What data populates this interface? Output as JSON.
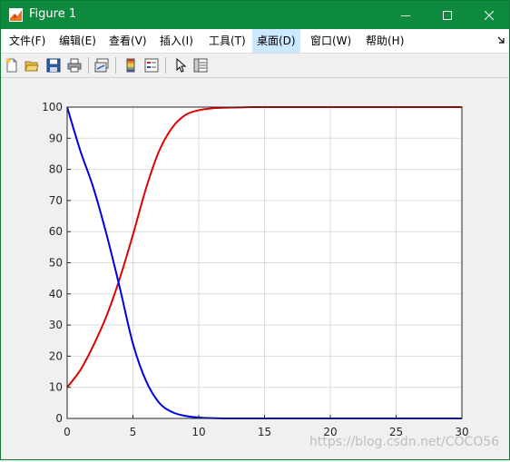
{
  "window": {
    "title": "Figure 1",
    "controls": {
      "minimize": "minimize",
      "maximize": "maximize",
      "close": "close"
    }
  },
  "menubar": {
    "items": [
      {
        "label": "文件(F)"
      },
      {
        "label": "编辑(E)"
      },
      {
        "label": "查看(V)"
      },
      {
        "label": "插入(I)"
      },
      {
        "label": "工具(T)"
      },
      {
        "label": "桌面(D)",
        "active": true
      },
      {
        "label": "窗口(W)"
      },
      {
        "label": "帮助(H)"
      }
    ]
  },
  "toolbar": {
    "buttons": [
      {
        "icon": "new-figure-icon"
      },
      {
        "icon": "open-file-icon"
      },
      {
        "icon": "save-icon"
      },
      {
        "icon": "print-icon"
      },
      {
        "icon": "link-plot-icon"
      },
      {
        "icon": "insert-colorbar-icon"
      },
      {
        "icon": "insert-legend-icon"
      },
      {
        "icon": "edit-plot-pointer-icon"
      },
      {
        "icon": "property-inspector-icon"
      }
    ]
  },
  "colors": {
    "titlebar": "#0e8a3e",
    "series_red": "#e00000",
    "series_blue": "#0000e6",
    "grid": "#dcdcdc"
  },
  "chart_data": {
    "type": "line",
    "title": "",
    "xlabel": "",
    "ylabel": "",
    "xlim": [
      0,
      30
    ],
    "ylim": [
      0,
      100
    ],
    "xticks": [
      0,
      5,
      10,
      15,
      20,
      25,
      30
    ],
    "yticks": [
      0,
      10,
      20,
      30,
      40,
      50,
      60,
      70,
      80,
      90,
      100
    ],
    "grid": true,
    "series": [
      {
        "color": "#e00000",
        "x": [
          0,
          1,
          2,
          3,
          4,
          5,
          6,
          7,
          8,
          9,
          10,
          11,
          12,
          13,
          14,
          15,
          16,
          18,
          20,
          25,
          30
        ],
        "values": [
          10,
          15.5,
          23.5,
          33,
          45,
          59,
          74,
          86,
          93.5,
          97.5,
          99,
          99.6,
          99.8,
          99.9,
          100,
          100,
          100,
          100,
          100,
          100,
          100
        ]
      },
      {
        "color": "#0000e6",
        "x": [
          0,
          1,
          2,
          3,
          4,
          5,
          6,
          7,
          8,
          9,
          10,
          11,
          12,
          13,
          14,
          15,
          16,
          18,
          20,
          25,
          30
        ],
        "values": [
          100,
          86,
          74,
          59,
          42,
          24,
          12,
          5,
          2,
          0.8,
          0.3,
          0.1,
          0,
          0,
          0,
          0,
          0,
          0,
          0,
          0,
          0
        ]
      }
    ]
  },
  "watermark": "https://blog.csdn.net/COCO56"
}
